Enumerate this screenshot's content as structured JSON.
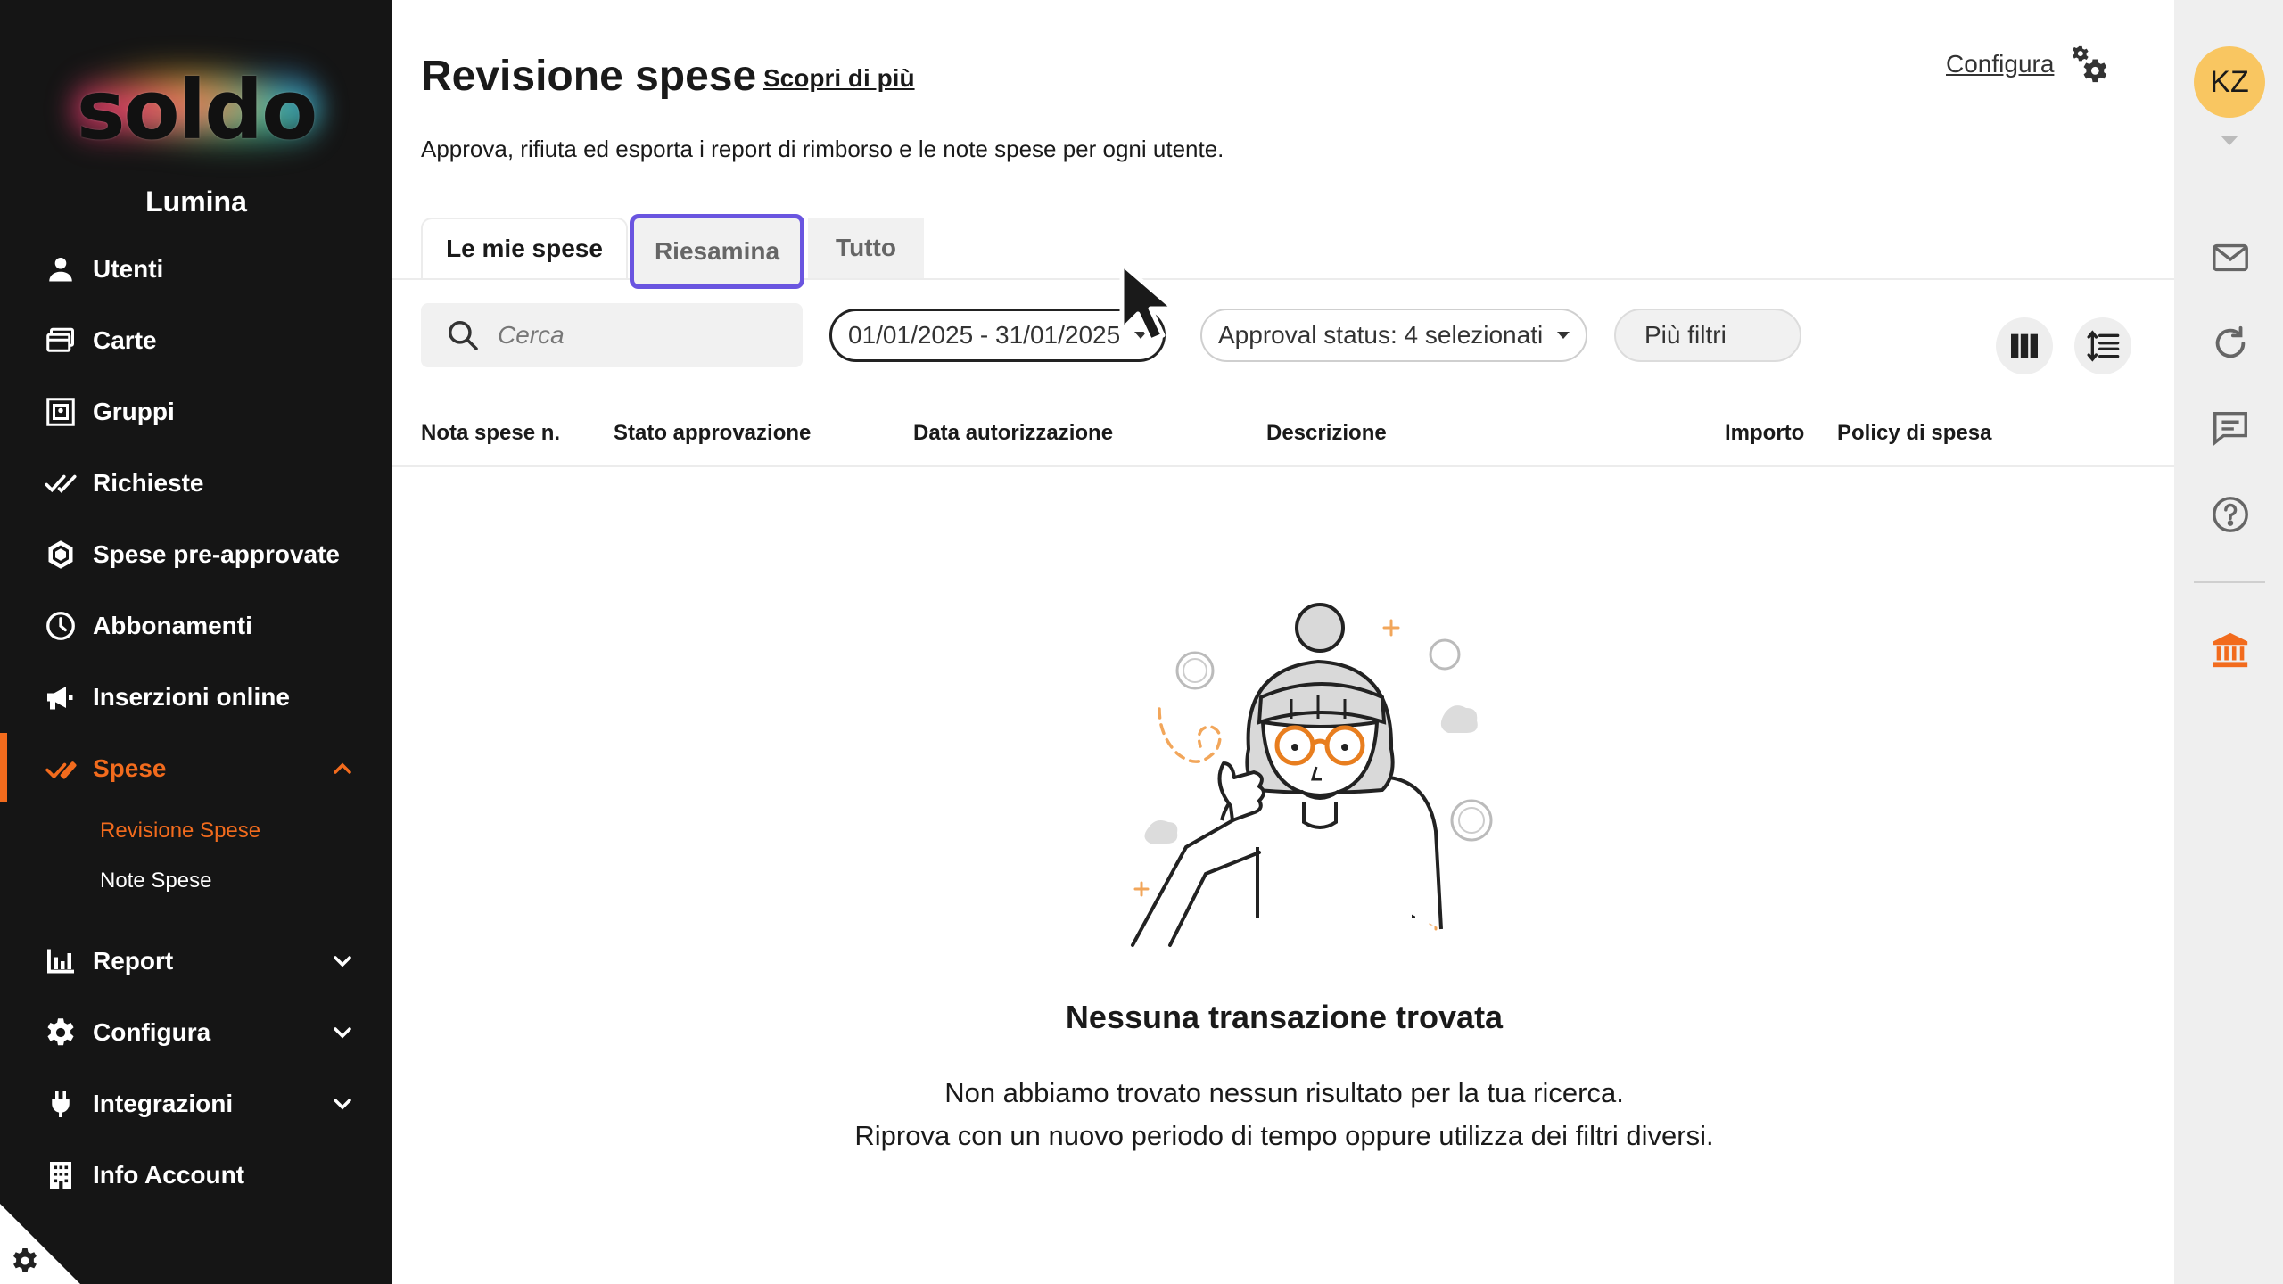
{
  "sidebar": {
    "logo": "soldo",
    "org_name": "Lumina",
    "items": [
      {
        "label": "Utenti",
        "icon": "user-icon"
      },
      {
        "label": "Carte",
        "icon": "card-icon"
      },
      {
        "label": "Gruppi",
        "icon": "groups-icon"
      },
      {
        "label": "Richieste",
        "icon": "double-check-icon"
      },
      {
        "label": "Spese pre-approvate",
        "icon": "hexagon-icon"
      },
      {
        "label": "Abbonamenti",
        "icon": "clock-icon"
      },
      {
        "label": "Inserzioni online",
        "icon": "megaphone-icon"
      },
      {
        "label": "Spese",
        "icon": "check-pen-icon",
        "active": true,
        "expanded": true
      },
      {
        "label": "Report",
        "icon": "bar-chart-icon"
      },
      {
        "label": "Configura",
        "icon": "gear-icon"
      },
      {
        "label": "Integrazioni",
        "icon": "plug-icon"
      },
      {
        "label": "Info Account",
        "icon": "building-icon"
      }
    ],
    "sub_items": [
      {
        "label": "Revisione Spese",
        "active": true
      },
      {
        "label": "Note Spese"
      }
    ]
  },
  "header": {
    "title": "Revisione spese",
    "learn_more": "Scopri di più",
    "configure": "Configura",
    "subtitle": "Approva, rifiuta ed esporta i report di rimborso e le note spese per ogni utente."
  },
  "tabs": [
    {
      "label": "Le mie spese",
      "active": true
    },
    {
      "label": "Riesamina",
      "focused": true
    },
    {
      "label": "Tutto"
    }
  ],
  "filters": {
    "search_placeholder": "Cerca",
    "date_range": "01/01/2025 - 31/01/2025",
    "approval_status": "Approval status: 4 selezionati",
    "more_filters": "Più filtri"
  },
  "table": {
    "columns": [
      "Nota spese n.",
      "Stato approvazione",
      "Data autorizzazione",
      "Descrizione",
      "Importo",
      "Policy di spesa"
    ]
  },
  "empty_state": {
    "title": "Nessuna transazione trovata",
    "line1": "Non abbiamo trovato nessun risultato per la tua ricerca.",
    "line2": "Riprova con un nuovo periodo di tempo oppure utilizza dei filtri diversi."
  },
  "user": {
    "initials": "KZ"
  },
  "colors": {
    "accent": "#f26b1d",
    "sidebar_bg": "#151515",
    "focus": "#6a55e0",
    "avatar": "#f9c661"
  }
}
